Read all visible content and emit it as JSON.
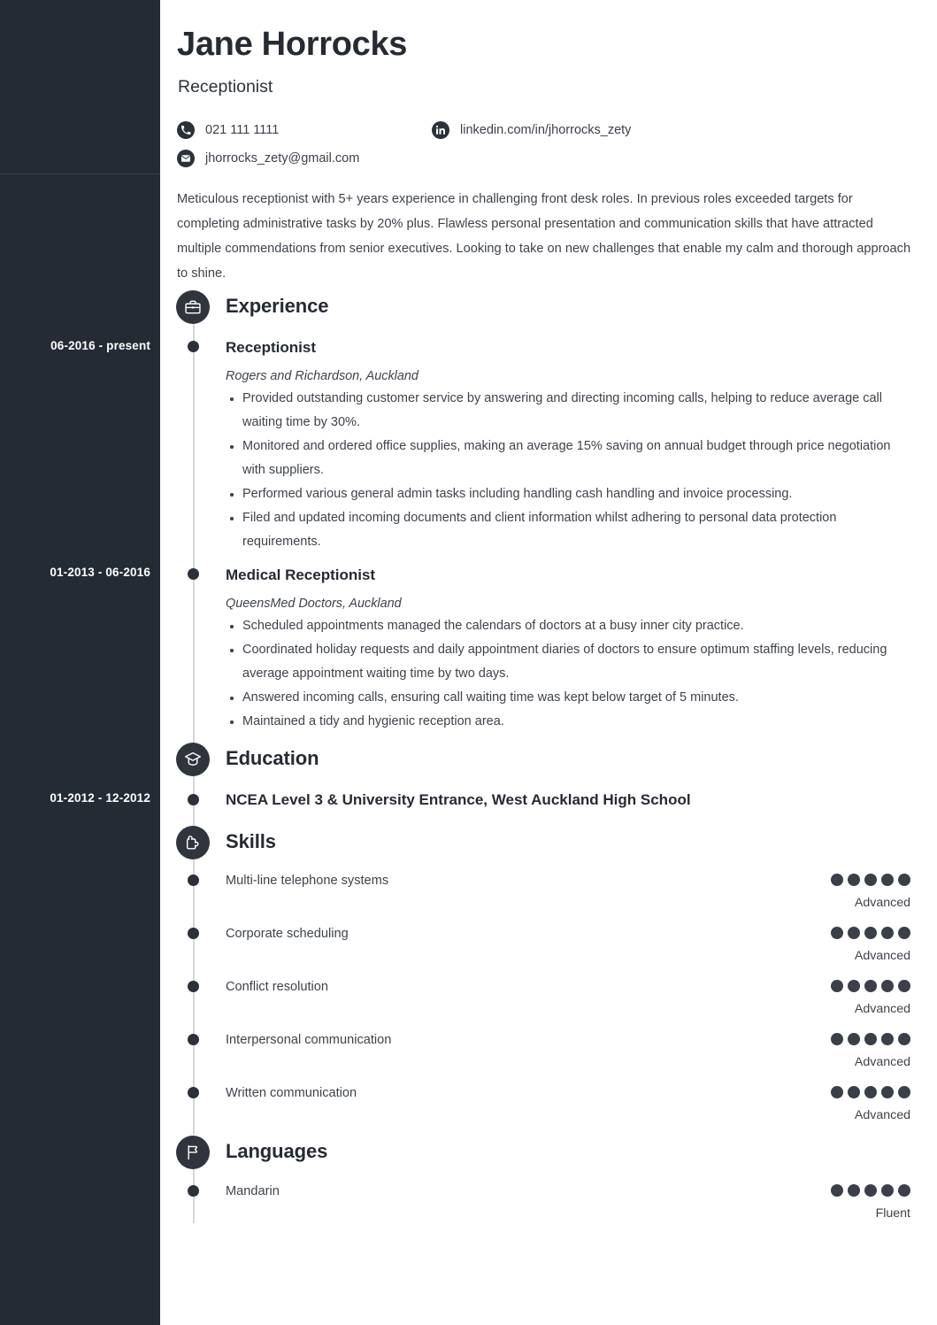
{
  "theme": {
    "sidebar_bg": "#252b35",
    "page_bg": "#ffffff",
    "accent_dark": "#2b303a",
    "text": "#3e434b",
    "heading": "#262b33",
    "timeline_line": "#d5d6d8",
    "dot_filled": "#3a3f49",
    "dot_empty": "#d6d7da"
  },
  "header": {
    "name": "Jane Horrocks",
    "job_title": "Receptionist",
    "contacts": {
      "phone": "021 111 1111",
      "linkedin": "linkedin.com/in/jhorrocks_zety",
      "email": "jhorrocks_zety@gmail.com"
    }
  },
  "summary": "Meticulous receptionist with 5+ years experience in challenging front desk roles. In previous roles exceeded targets for completing administrative tasks by 20% plus. Flawless personal presentation and communication skills that have attracted multiple commendations from senior executives. Looking to take on new challenges that enable my calm and thorough approach to shine.",
  "sections": {
    "experience": {
      "title": "Experience",
      "icon": "briefcase-icon",
      "entries": [
        {
          "date": "06-2016 - present",
          "role": "Receptionist",
          "employer": "Rogers and Richardson, Auckland",
          "bullets": [
            "Provided outstanding customer service by answering and directing incoming calls, helping to reduce average call waiting time by 30%.",
            "Monitored and ordered office supplies, making an average 15% saving on annual budget through price negotiation with suppliers.",
            "Performed various general admin tasks including handling cash handling and invoice processing.",
            "Filed and updated incoming documents and client information whilst adhering to personal data protection requirements."
          ]
        },
        {
          "date": "01-2013 - 06-2016",
          "role": "Medical Receptionist",
          "employer": "QueensMed Doctors, Auckland",
          "bullets": [
            "Scheduled appointments managed the calendars of doctors at a busy inner city practice.",
            "Coordinated holiday requests and daily appointment diaries of doctors to ensure optimum staffing levels, reducing average appointment waiting time by two days.",
            "Answered incoming calls, ensuring call waiting time was kept below target of 5 minutes.",
            "Maintained a tidy and hygienic reception area."
          ]
        }
      ]
    },
    "education": {
      "title": "Education",
      "icon": "graduation-cap-icon",
      "entries": [
        {
          "date": "01-2012 - 12-2012",
          "qualification": "NCEA Level 3 & University Entrance, West Auckland High School"
        }
      ]
    },
    "skills": {
      "title": "Skills",
      "icon": "puzzle-icon",
      "max_rating": 5,
      "items": [
        {
          "name": "Multi-line telephone systems",
          "rating": 5,
          "level": "Advanced"
        },
        {
          "name": "Corporate scheduling",
          "rating": 5,
          "level": "Advanced"
        },
        {
          "name": "Conflict resolution",
          "rating": 5,
          "level": "Advanced"
        },
        {
          "name": "Interpersonal communication",
          "rating": 5,
          "level": "Advanced"
        },
        {
          "name": "Written communication",
          "rating": 5,
          "level": "Advanced"
        }
      ]
    },
    "languages": {
      "title": "Languages",
      "icon": "flag-icon",
      "max_rating": 5,
      "items": [
        {
          "name": "Mandarin",
          "rating": 5,
          "level": "Fluent"
        }
      ]
    }
  }
}
